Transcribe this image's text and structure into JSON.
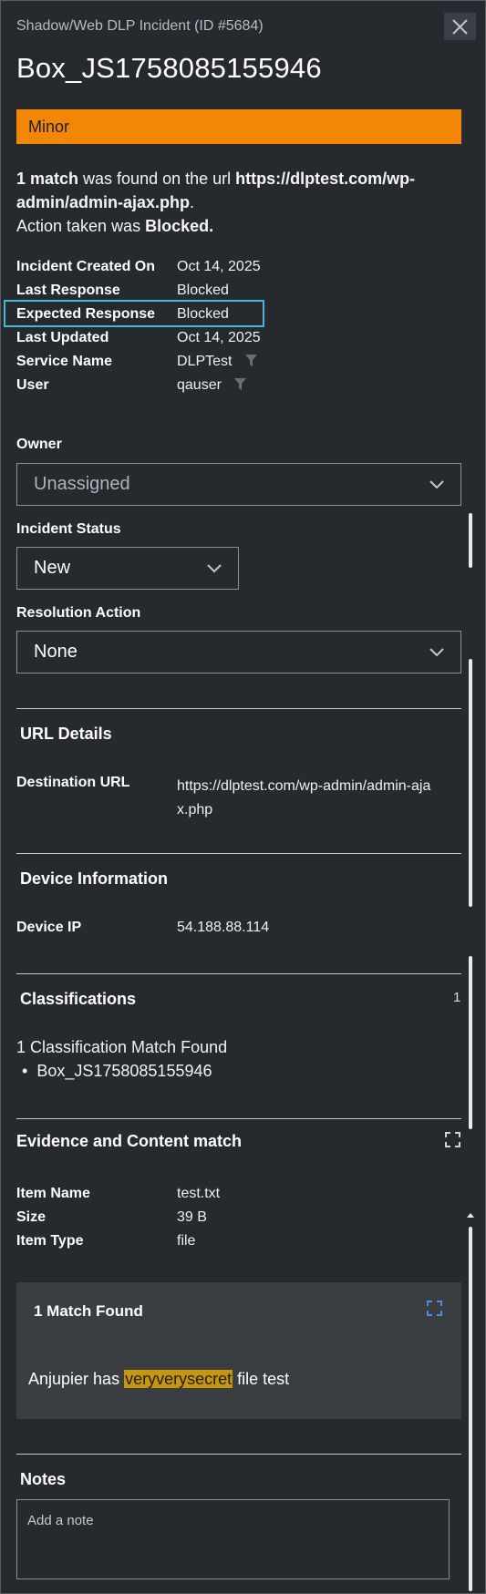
{
  "header": {
    "subtitle": "Shadow/Web DLP Incident (ID #5684)",
    "title": "Box_JS1758085155946",
    "close_icon": "close-icon"
  },
  "severity": {
    "label": "Minor",
    "color": "#f28705"
  },
  "summary": {
    "match_count": "1 match",
    "found_text": " was found on the url ",
    "url": "https://dlptest.com/wp-admin/admin-ajax.php",
    "period": ".",
    "action_prefix": "Action taken was ",
    "action": "Blocked."
  },
  "details": [
    {
      "label": "Incident Created On",
      "value": "Oct 14, 2025"
    },
    {
      "label": "Last Response",
      "value": "Blocked"
    },
    {
      "label": "Expected Response",
      "value": "Blocked"
    },
    {
      "label": "Last Updated",
      "value": "Oct 14, 2025"
    },
    {
      "label": "Service Name",
      "value": "DLPTest"
    },
    {
      "label": "User",
      "value": "qauser"
    }
  ],
  "owner": {
    "label": "Owner",
    "value": "Unassigned"
  },
  "incident_status": {
    "label": "Incident Status",
    "value": "New"
  },
  "resolution_action": {
    "label": "Resolution Action",
    "value": "None"
  },
  "url_details": {
    "title": "URL Details",
    "destination_label": "Destination URL",
    "destination_line1": "https://dlptest.com/wp-admin/admin-aja",
    "destination_line2": "x.php"
  },
  "device_info": {
    "title": "Device Information",
    "ip_label": "Device IP",
    "ip_value": "54.188.88.114"
  },
  "classifications": {
    "title": "Classifications",
    "count": "1",
    "summary": "1 Classification Match Found",
    "items": [
      "Box_JS1758085155946"
    ]
  },
  "evidence": {
    "title": "Evidence and Content match",
    "items": [
      {
        "label": "Item Name",
        "value": "test.txt"
      },
      {
        "label": "Size",
        "value": "39 B"
      },
      {
        "label": "Item Type",
        "value": "file"
      }
    ],
    "match_box": {
      "title": "1 Match Found",
      "text_before": "Anjupier has ",
      "highlight": "veryverysecret",
      "text_after": " file test"
    }
  },
  "notes": {
    "title": "Notes",
    "placeholder": "Add a note"
  },
  "colors": {
    "accent_highlight": "#47b6d6",
    "match_highlight": "#c8960c",
    "expand_blue": "#4a8fe0"
  }
}
